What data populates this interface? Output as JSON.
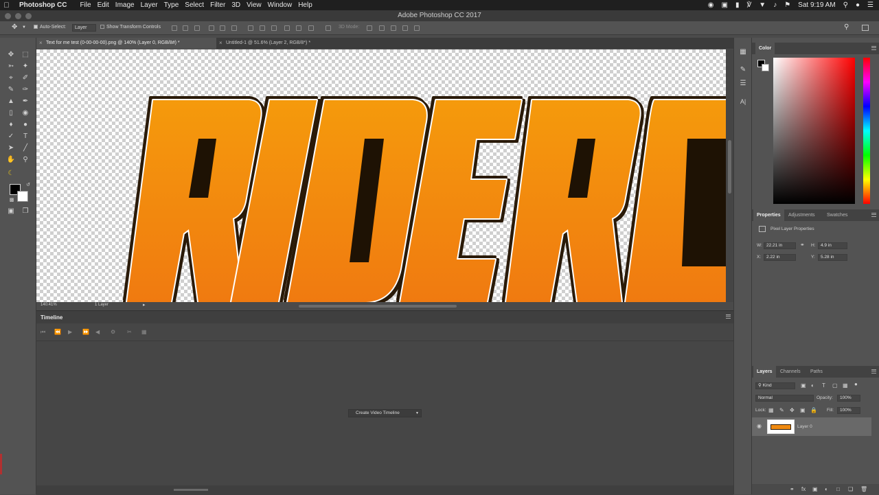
{
  "menubar": {
    "app_name": "Photoshop CC",
    "items": [
      "File",
      "Edit",
      "Image",
      "Layer",
      "Type",
      "Select",
      "Filter",
      "3D",
      "View",
      "Window",
      "Help"
    ],
    "clock": "Sat 9:19 AM"
  },
  "window": {
    "title": "Adobe Photoshop CC 2017"
  },
  "options": {
    "auto_select_label": "Auto-Select:",
    "auto_select_value": "Layer",
    "show_transform_label": "Show Transform Controls",
    "mode_3d_label": "3D Mode:"
  },
  "tabs": [
    {
      "label": "Text for me test (0-00-00-00).png @ 140% (Layer 0, RGB/8#) *",
      "active": true
    },
    {
      "label": "Untitled-1 @ 51.6% (Layer 2, RGB/8*) *",
      "active": false
    }
  ],
  "canvas": {
    "artwork_text": "RIDERG",
    "gradient_top": "#f59a0c",
    "gradient_bottom": "#f07a10",
    "outline_color": "#2a1a08"
  },
  "status": {
    "zoom": "140.41%",
    "info": "1 Layer"
  },
  "timeline": {
    "title": "Timeline",
    "create_button": "Create Video Timeline"
  },
  "color_panel": {
    "tab": "Color",
    "accent_color": "#ff0000"
  },
  "properties_panel": {
    "tabs": [
      "Properties",
      "Adjustments",
      "Swatches"
    ],
    "header": "Pixel Layer Properties",
    "w_label": "W:",
    "w_value": "22.21 in",
    "h_label": "H:",
    "h_value": "4.9 in",
    "x_label": "X:",
    "x_value": "2.22 in",
    "y_label": "Y:",
    "y_value": "5.28 in"
  },
  "layers_panel": {
    "tabs": [
      "Layers",
      "Channels",
      "Paths"
    ],
    "kind_label": "Kind",
    "blend_mode": "Normal",
    "opacity_label": "Opacity:",
    "opacity_value": "100%",
    "lock_label": "Lock:",
    "fill_label": "Fill:",
    "fill_value": "100%",
    "layers": [
      {
        "name": "Layer 0",
        "visible": true
      }
    ]
  }
}
